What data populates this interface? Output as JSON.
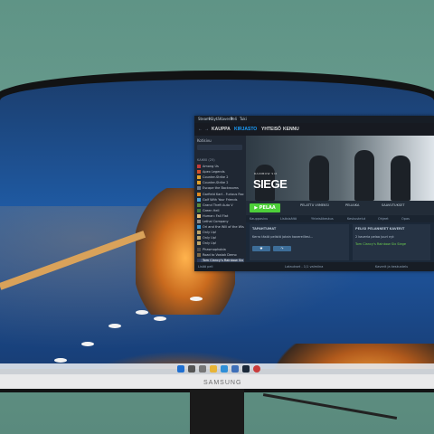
{
  "steam": {
    "menu": [
      "Steam",
      "Näytä",
      "Kaverit",
      "Peli",
      "Tuki"
    ],
    "nav": [
      "KAUPPA",
      "KIRJASTO",
      "YHTEISÖ",
      "KENNU"
    ],
    "nav_active_index": 1,
    "library_label": "Kotisivu",
    "category_label": "KAIKKI (25)",
    "games": [
      "Among Us",
      "Apex Legends",
      "Counter-Strike 2",
      "Counter-Strike 2",
      "Escape the Backrooms",
      "Garfield Kart - Furious Racing",
      "Golf With Your Friends",
      "Grand Theft Auto V",
      "Green Hell",
      "Human: Fall Flat",
      "Lethal Company",
      "Ori and the Will of the Wisps",
      "Only Up!",
      "Only Up!",
      "Only Up!",
      "Phasmophobia",
      "Road to Vostok Demo",
      "Tom Clancy's Rainbow Six Siege",
      "Tom Clancy's Rainbow Six Siege"
    ],
    "selected_game_index": 17,
    "hero_title": "SIEGE",
    "hero_sub": "RAINBOW SIX",
    "play_label": "PELAA",
    "stats": [
      "PELATTU VIIMEKSI",
      "PELIAIKA",
      "SAAVUTUKSET"
    ],
    "tabs": [
      "Kauppasivu",
      "Lisäsisältö",
      "Yhteisökeskus",
      "Keskustelut",
      "Ohjeet",
      "Opas"
    ],
    "activity_title": "TAPAHTUMAT",
    "activity_text": "Kerro tästä pelistä jotain kavereillesi...",
    "friends_title": "PELISI PELANNEET KAVERIT",
    "friends_count_text": "2 kaveria pelaa juuri nyt",
    "friend_game": "Tom Clancy's Rainbow Six Siege",
    "bottom_left": "Lisää peli",
    "bottom_mid": "Lataukset - 1/1 valmiina",
    "bottom_right": "Kaverit ja keskustelu"
  },
  "monitor": {
    "brand": "SAMSUNG"
  }
}
